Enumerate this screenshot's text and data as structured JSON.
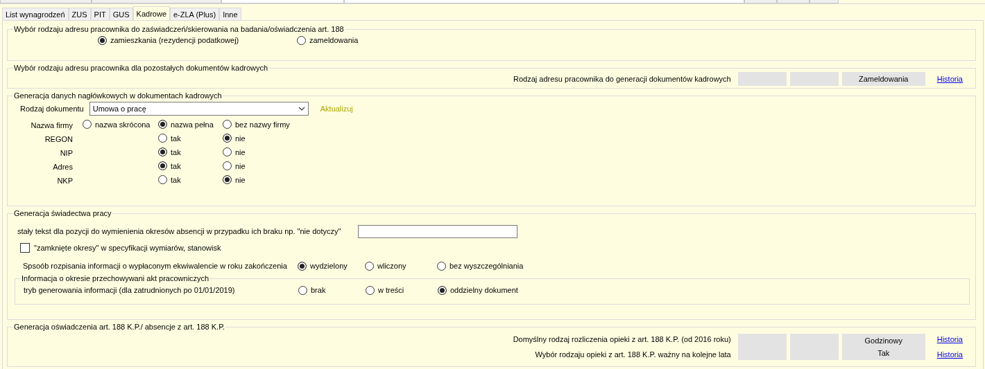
{
  "tabs": [
    {
      "label": "List wynagrodzeń",
      "selected": false
    },
    {
      "label": "ZUS",
      "selected": false
    },
    {
      "label": "PIT",
      "selected": false
    },
    {
      "label": "GUS",
      "selected": false
    },
    {
      "label": "Kadrowe",
      "selected": true
    },
    {
      "label": "e-ZLA (Plus)",
      "selected": false
    },
    {
      "label": "Inne",
      "selected": false
    }
  ],
  "address_certificates": {
    "legend": "Wybór rodzaju adresu pracownika do zaświadczeń/skierowania na badania/oświadczenia art. 188",
    "options": [
      {
        "label": "zamieszkania (rezydencji podatkowej)",
        "selected": true
      },
      {
        "label": "zameldowania",
        "selected": false
      }
    ]
  },
  "address_other": {
    "legend": "Wybór rodzaju adresu pracownika dla pozostałych dokumentów kadrowych",
    "label": "Rodzaj adresu pracownika do generacji dokumentów kadrowych",
    "value": "Zameldowania",
    "link": "Historia"
  },
  "header_data": {
    "legend": "Generacja danych nagłówkowych w dokumentach kadrowych",
    "document_label": "Rodzaj dokumentu",
    "document_value": "Umowa o pracę",
    "update_link": "Aktualizuj",
    "rows": [
      {
        "label": "Nazwa firmy",
        "options": [
          {
            "label": "nazwa skrócona",
            "selected": false
          },
          {
            "label": "nazwa pełna",
            "selected": true
          },
          {
            "label": "bez nazwy firmy",
            "selected": false
          }
        ]
      },
      {
        "label": "REGON",
        "options": [
          {
            "label": "tak",
            "selected": false
          },
          {
            "label": "nie",
            "selected": true
          }
        ]
      },
      {
        "label": "NIP",
        "options": [
          {
            "label": "tak",
            "selected": true
          },
          {
            "label": "nie",
            "selected": false
          }
        ]
      },
      {
        "label": "Adres",
        "options": [
          {
            "label": "tak",
            "selected": true
          },
          {
            "label": "nie",
            "selected": false
          }
        ]
      },
      {
        "label": "NKP",
        "options": [
          {
            "label": "tak",
            "selected": false
          },
          {
            "label": "nie",
            "selected": true
          }
        ]
      }
    ]
  },
  "certificate": {
    "legend": "Generacja świadectwa pracy",
    "fixed_text": {
      "label": "stały tekst dla pozycji do wymienienia okresów absencji w przypadku ich braku np. \"nie dotyczy\""
    },
    "checkbox": {
      "label": "\"zamknięte okresy\" w specyfikacji wymiarów, stanowisk",
      "checked": false
    },
    "settlement": {
      "label": "Spsoób rozpisania informacji o wypłaconym ekwiwalencie w roku zakończenia",
      "options": [
        {
          "label": "wydzielony",
          "selected": true
        },
        {
          "label": "wliczony",
          "selected": false
        },
        {
          "label": "bez wyszczególniania",
          "selected": false
        }
      ]
    },
    "storage": {
      "legend": "Informacja o okresie przechowywani akt pracowniczych",
      "label": "tryb generowania informacji (dla zatrudnionych po 01/01/2019)",
      "options": [
        {
          "label": "brak",
          "selected": false
        },
        {
          "label": "w treści",
          "selected": false
        },
        {
          "label": "oddzielny dokument",
          "selected": true
        }
      ]
    }
  },
  "statement": {
    "legend": "Generacja oświadczenia art. 188 K.P./ absencje z art. 188 K.P.",
    "rows": [
      {
        "label": "Domyślny rodzaj rozliczenia opieki z art. 188 K.P. (od 2016 roku)",
        "value": "Godzinowy",
        "link": "Historia"
      },
      {
        "label": "Wybór rodzaju opieki z art. 188 K.P. ważny na kolejne lata",
        "value": "Tak",
        "link": "Historia"
      }
    ]
  }
}
